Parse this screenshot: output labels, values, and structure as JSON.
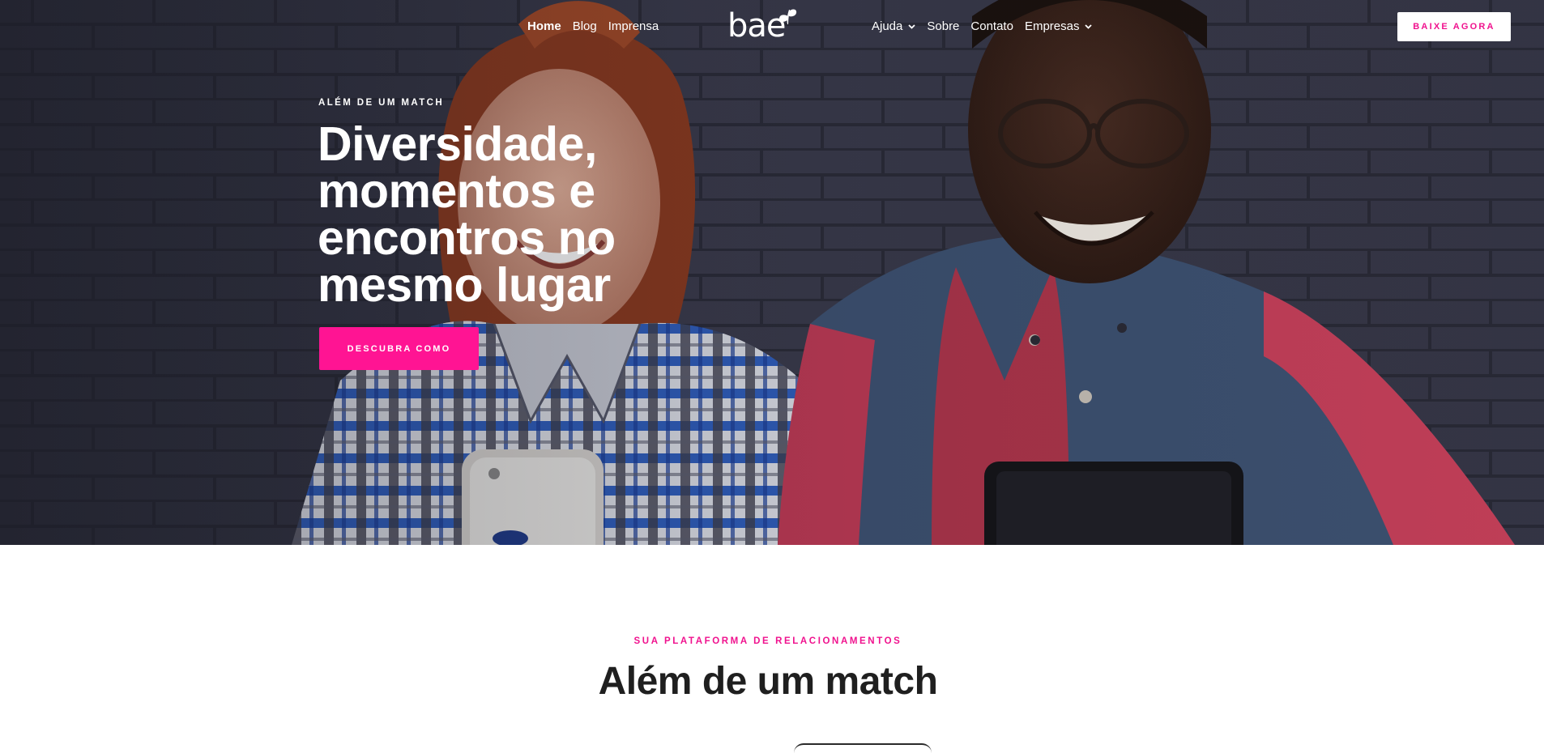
{
  "nav": {
    "left": [
      {
        "label": "Home",
        "active": true
      },
      {
        "label": "Blog",
        "active": false
      },
      {
        "label": "Imprensa",
        "active": false
      }
    ],
    "right": [
      {
        "label": "Ajuda",
        "dropdown": true
      },
      {
        "label": "Sobre",
        "dropdown": false
      },
      {
        "label": "Contato",
        "dropdown": false
      },
      {
        "label": "Empresas",
        "dropdown": true
      }
    ],
    "logo_text": "bae",
    "logo_icon": "butterfly-icon",
    "download_label": "BAIXE AGORA"
  },
  "hero": {
    "eyebrow": "ALÉM DE UM MATCH",
    "title": "Diversidade, momentos e encontros no mesmo lugar",
    "cta_label": "DESCUBRA COMO"
  },
  "section": {
    "eyebrow": "SUA PLATAFORMA DE RELACIONAMENTOS",
    "title": "Além de um match"
  },
  "colors": {
    "brand_pink": "#ff1493",
    "brand_pink_text": "#f0128e",
    "hero_dark": "#2b2d3a",
    "heading_dark": "#1f1f1f"
  }
}
